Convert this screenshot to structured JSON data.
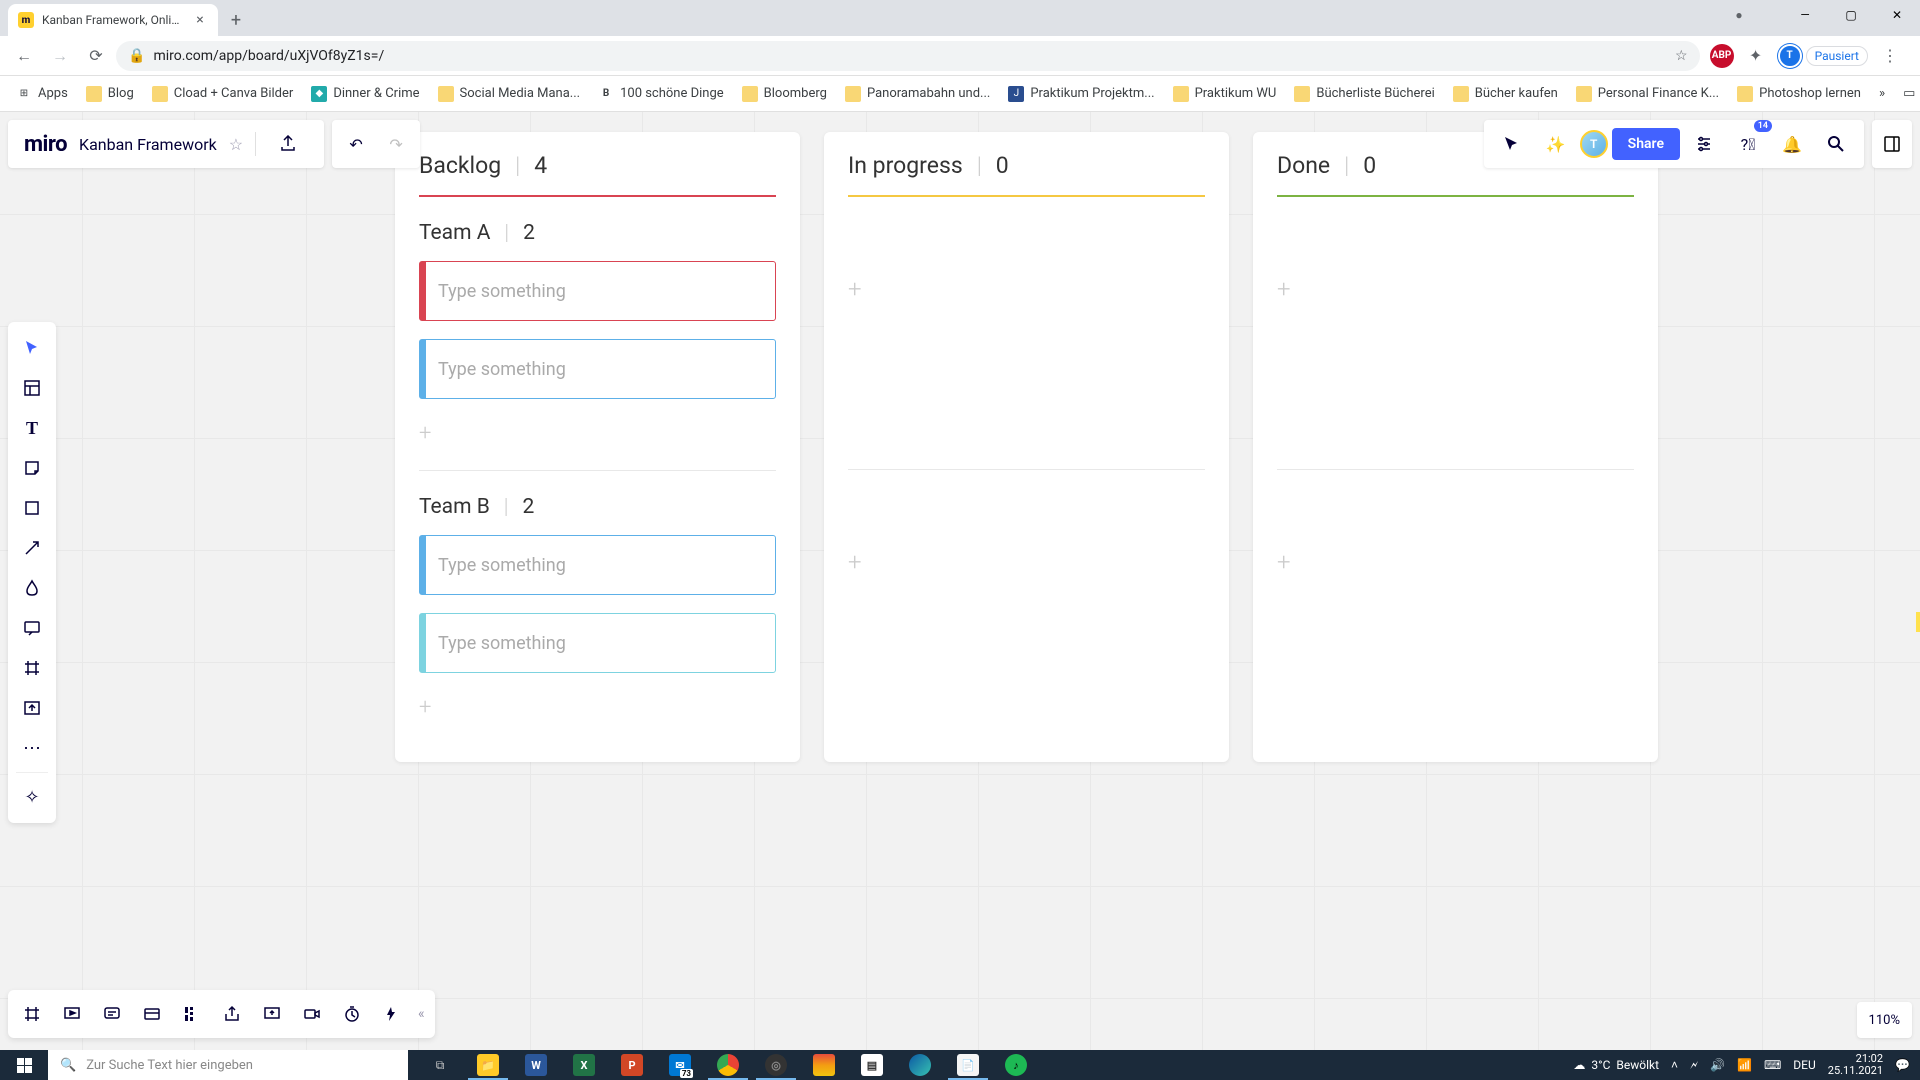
{
  "browser": {
    "tab_title": "Kanban Framework, Online Whit",
    "url": "miro.com/app/board/uXjVOf8yZ1s=/",
    "profile_status": "Pausiert",
    "window_controls": {
      "min": "—",
      "max": "▢",
      "close": "✕"
    }
  },
  "bookmarks": [
    {
      "icon": "apps",
      "label": "Apps"
    },
    {
      "icon": "folder",
      "label": "Blog"
    },
    {
      "icon": "folder",
      "label": "Cload + Canva Bilder"
    },
    {
      "icon": "teal",
      "label": "Dinner & Crime"
    },
    {
      "icon": "folder",
      "label": "Social Media Mana..."
    },
    {
      "icon": "b",
      "label": "100 schöne Dinge"
    },
    {
      "icon": "folder",
      "label": "Bloomberg"
    },
    {
      "icon": "folder",
      "label": "Panoramabahn und..."
    },
    {
      "icon": "blue",
      "label": "Praktikum Projektm..."
    },
    {
      "icon": "folder",
      "label": "Praktikum WU"
    },
    {
      "icon": "folder",
      "label": "Bücherliste Bücherei"
    },
    {
      "icon": "folder",
      "label": "Bücher kaufen"
    },
    {
      "icon": "folder",
      "label": "Personal Finance K..."
    },
    {
      "icon": "folder",
      "label": "Photoshop lernen"
    }
  ],
  "bookmark_overflow": "»",
  "reading_list": "Leseliste",
  "miro": {
    "logo": "miro",
    "board_name": "Kanban Framework",
    "share": "Share",
    "notif_count": "14",
    "avatar_initial": "T",
    "zoom": "110%"
  },
  "kanban": {
    "columns": [
      {
        "title": "Backlog",
        "count": "4",
        "color": "red"
      },
      {
        "title": "In progress",
        "count": "0",
        "color": "yellow"
      },
      {
        "title": "Done",
        "count": "0",
        "color": "green"
      }
    ],
    "swimlanes": [
      {
        "title": "Team A",
        "count": "2",
        "cards": [
          {
            "color": "red",
            "text": "Type something"
          },
          {
            "color": "blue",
            "text": "Type something"
          }
        ]
      },
      {
        "title": "Team B",
        "count": "2",
        "cards": [
          {
            "color": "blue",
            "text": "Type something"
          },
          {
            "color": "cyan",
            "text": "Type something"
          }
        ]
      }
    ],
    "add_label": "+"
  },
  "taskbar": {
    "search_placeholder": "Zur Suche Text hier eingeben",
    "weather_temp": "3°C",
    "weather_cond": "Bewölkt",
    "lang": "DEU",
    "time": "21:02",
    "date": "25.11.2021",
    "mail_count": "73"
  }
}
